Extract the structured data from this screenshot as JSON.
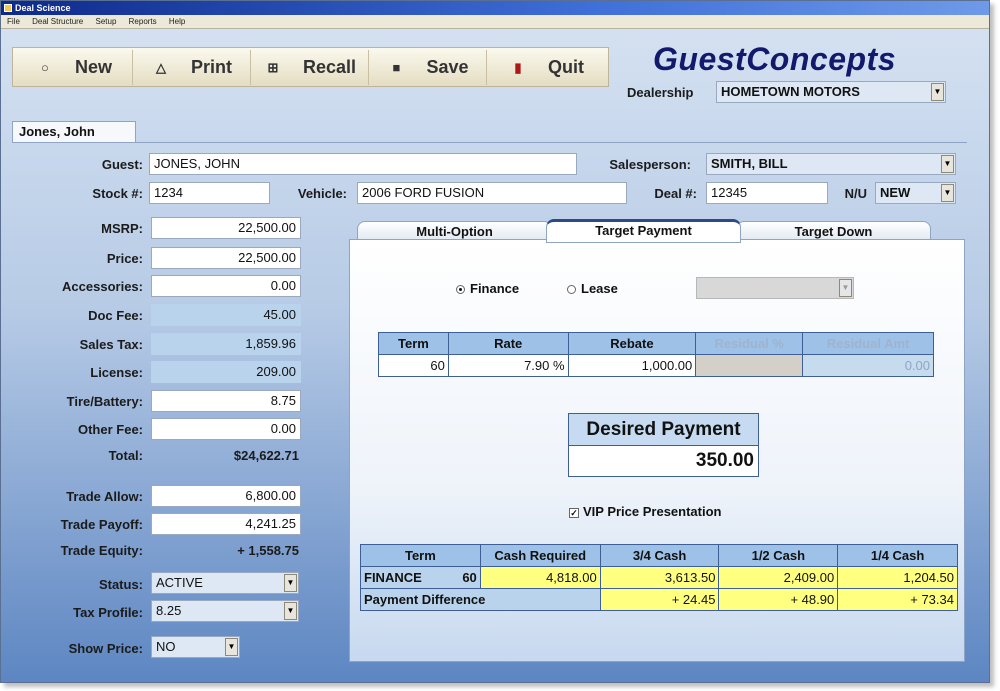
{
  "window": {
    "title": "Deal Science"
  },
  "menu": [
    "File",
    "Deal Structure",
    "Setup",
    "Reports",
    "Help"
  ],
  "toolbar": {
    "new_label": "New",
    "print_label": "Print",
    "recall_label": "Recall",
    "save_label": "Save",
    "quit_label": "Quit",
    "icons": [
      "new-icon",
      "print-icon",
      "recall-icon",
      "save-icon",
      "quit-icon"
    ]
  },
  "brand": {
    "logo": "GuestConcepts",
    "accent": "#131a6b"
  },
  "dealership": {
    "label": "Dealership",
    "value": "HOMETOWN MOTORS"
  },
  "document_tab": "Jones, John",
  "guest": {
    "label": "Guest:",
    "value": "JONES, JOHN"
  },
  "salesperson": {
    "label": "Salesperson:",
    "value": "SMITH, BILL"
  },
  "stock": {
    "label": "Stock #:",
    "value": "1234"
  },
  "vehicle": {
    "label": "Vehicle:",
    "value": "2006 FORD FUSION"
  },
  "deal": {
    "label": "Deal #:",
    "value": "12345"
  },
  "nu": {
    "label": "N/U",
    "value": "NEW"
  },
  "left_fields": {
    "msrp": {
      "label": "MSRP:",
      "value": "22,500.00"
    },
    "price": {
      "label": "Price:",
      "value": "22,500.00"
    },
    "accessories": {
      "label": "Accessories:",
      "value": "0.00"
    },
    "doc_fee": {
      "label": "Doc Fee:",
      "value": "45.00"
    },
    "sales_tax": {
      "label": "Sales Tax:",
      "value": "1,859.96"
    },
    "license": {
      "label": "License:",
      "value": "209.00"
    },
    "tire_battery": {
      "label": "Tire/Battery:",
      "value": "8.75"
    },
    "other_fee": {
      "label": "Other Fee:",
      "value": "0.00"
    },
    "total": {
      "label": "Total:",
      "value": "$24,622.71"
    },
    "trade_allow": {
      "label": "Trade Allow:",
      "value": "6,800.00"
    },
    "trade_payoff": {
      "label": "Trade Payoff:",
      "value": "4,241.25"
    },
    "trade_equity": {
      "label": "Trade Equity:",
      "value": "+ 1,558.75"
    },
    "status": {
      "label": "Status:",
      "value": "ACTIVE"
    },
    "tax_profile": {
      "label": "Tax Profile:",
      "value": "8.25"
    },
    "show_price": {
      "label": "Show Price:",
      "value": "NO"
    }
  },
  "tabs": [
    "Multi-Option",
    "Target Payment",
    "Target Down"
  ],
  "active_tab": "Target Payment",
  "payment_type": {
    "finance": "Finance",
    "lease": "Lease",
    "selected": "Finance"
  },
  "terms_table": {
    "headers": [
      "Term",
      "Rate",
      "Rebate",
      "Residual %",
      "Residual Amt"
    ],
    "row": [
      "60",
      "7.90 %",
      "1,000.00",
      "",
      "0.00"
    ]
  },
  "desired_payment": {
    "label": "Desired Payment",
    "value": "350.00"
  },
  "vip": {
    "label": "VIP Price Presentation",
    "checked": true
  },
  "cash_table": {
    "headers": [
      "Term",
      "Cash Required",
      "3/4 Cash",
      "1/2 Cash",
      "1/4 Cash"
    ],
    "finance_row": {
      "label": "FINANCE",
      "term": "60",
      "values": [
        "4,818.00",
        "3,613.50",
        "2,409.00",
        "1,204.50"
      ]
    },
    "diff_row": {
      "label": "Payment Difference",
      "values": [
        "+ 24.45",
        "+ 48.90",
        "+ 73.34"
      ]
    }
  },
  "colors": {
    "highlight": "#ffff80",
    "readonly": "#b9d3ec",
    "header": "#9ec1e8"
  }
}
